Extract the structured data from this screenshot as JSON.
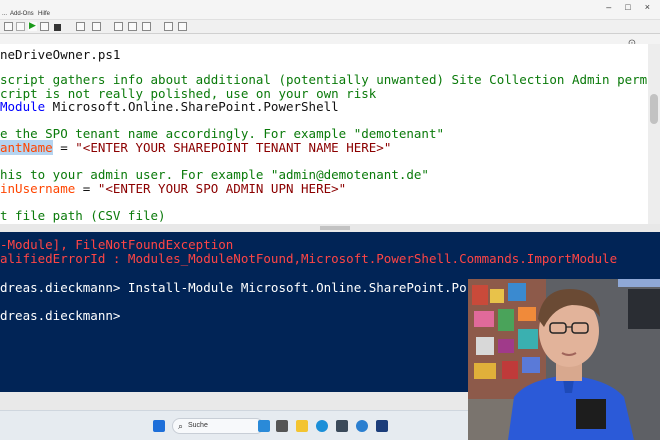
{
  "menu": [
    "...",
    "Add-Ons",
    "Hilfe"
  ],
  "window_controls": [
    "–",
    "□",
    "×"
  ],
  "tab": {
    "title": "neDriveOwner.ps1"
  },
  "script_lines": [
    {
      "parts": [
        {
          "t": "cmt",
          "v": "script gathers info about additional (potentially unwanted) Site Collection Admin perm"
        }
      ]
    },
    {
      "parts": [
        {
          "t": "cmt",
          "v": "cript is not really polished, use on your own risk"
        }
      ]
    },
    {
      "parts": [
        {
          "t": "cmd",
          "v": "Module"
        },
        {
          "t": "plain",
          "v": " Microsoft.Online.SharePoint.PowerShell"
        }
      ]
    },
    {
      "parts": []
    },
    {
      "parts": [
        {
          "t": "cmt",
          "v": "e the SPO tenant name accordingly. For example \"demotenant\""
        }
      ]
    },
    {
      "parts": [
        {
          "t": "sel",
          "v": "antName"
        },
        {
          "t": "plain",
          "v": " = "
        },
        {
          "t": "str",
          "v": "\"<ENTER YOUR SHAREPOINT TENANT NAME HERE>\""
        }
      ]
    },
    {
      "parts": []
    },
    {
      "parts": [
        {
          "t": "cmt",
          "v": "his to your admin user. For example \"admin@demotenant.de\""
        }
      ]
    },
    {
      "parts": [
        {
          "t": "var",
          "v": "inUsername"
        },
        {
          "t": "plain",
          "v": " = "
        },
        {
          "t": "str",
          "v": "\"<ENTER YOUR SPO ADMIN UPN HERE>\""
        }
      ]
    },
    {
      "parts": []
    },
    {
      "parts": [
        {
          "t": "cmt",
          "v": "t file path (CSV file)"
        }
      ]
    }
  ],
  "console_lines": [
    {
      "t": "err",
      "v": "-Module], FileNotFoundException"
    },
    {
      "t": "err",
      "v": "alifiedErrorId : Modules_ModuleNotFound,Microsoft.PowerShell.Commands.ImportModule"
    },
    {
      "t": "out",
      "v": ""
    },
    {
      "t": "out",
      "v": "dreas.dieckmann> Install-Module Microsoft.Online.SharePoint.Po"
    },
    {
      "t": "out",
      "v": ""
    },
    {
      "t": "out",
      "v": "dreas.dieckmann>"
    }
  ],
  "taskbar": {
    "search_placeholder": "Suche"
  },
  "colors": {
    "console_bg": "#012456",
    "comment": "#0a7a0a",
    "keyword": "#0000ff",
    "string": "#8b0000",
    "variable": "#ff4500",
    "error": "#ff4545"
  }
}
